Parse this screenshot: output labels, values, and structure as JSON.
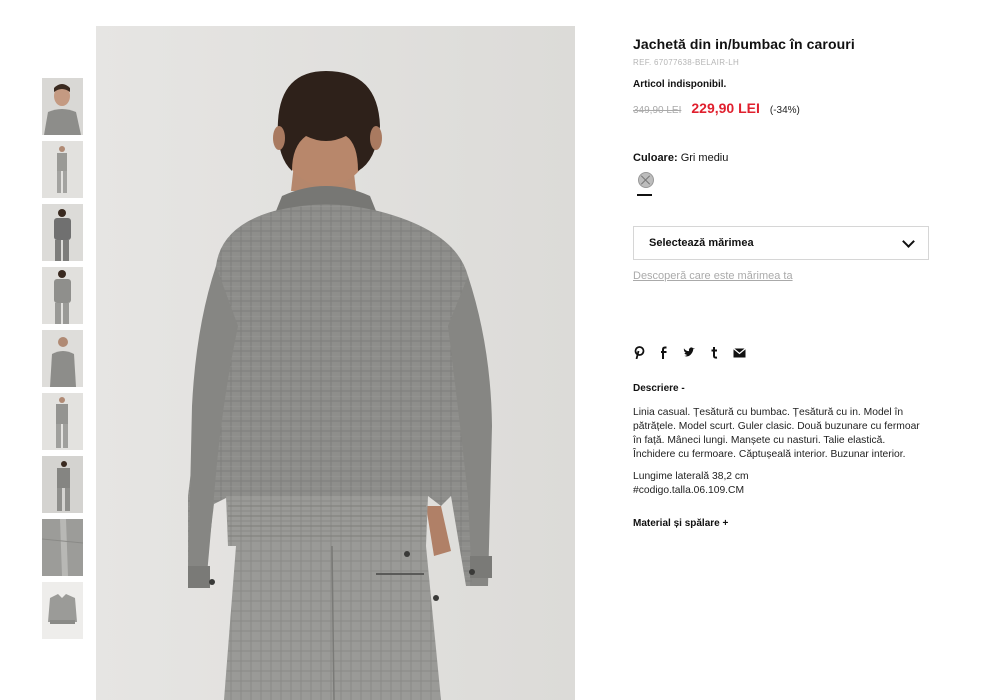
{
  "product": {
    "title": "Jachetă din in/bumbac în carouri",
    "ref": "REF. 67077638-BELAIR-LH",
    "availability": "Articol indisponibil.",
    "old_price": "349,90 LEI",
    "new_price": "229,90 LEI",
    "discount": "(-34%)",
    "price_color": "#e0202e"
  },
  "color": {
    "label": "Culoare:",
    "value": "Gri mediu"
  },
  "size": {
    "placeholder": "Selectează mărimea",
    "guide_link": "Descoperă care este mărimea ta"
  },
  "share": [
    {
      "icon": "pinterest-icon",
      "glyph": "𝒑"
    },
    {
      "icon": "facebook-icon",
      "glyph": "f"
    },
    {
      "icon": "twitter-icon",
      "glyph": "🐦"
    },
    {
      "icon": "tumblr-icon",
      "glyph": "t"
    },
    {
      "icon": "mail-icon",
      "glyph": "✉"
    }
  ],
  "description": {
    "heading": "Descriere -",
    "text": "Linia casual. Țesătură cu bumbac. Țesătură cu in. Model în pătrățele. Model scurt. Guler clasic. Două buzunare cu fermoar în față. Mâneci lungi. Manșete cu nasturi. Talie elastică. Închidere cu fermoare. Căptușeală interior. Buzunar interior.",
    "length": "Lungime laterală 38,2 cm",
    "code": "#codigo.talla.06.109.CM"
  },
  "material": {
    "heading": "Material și spălare +"
  },
  "thumbnails_count": 9
}
